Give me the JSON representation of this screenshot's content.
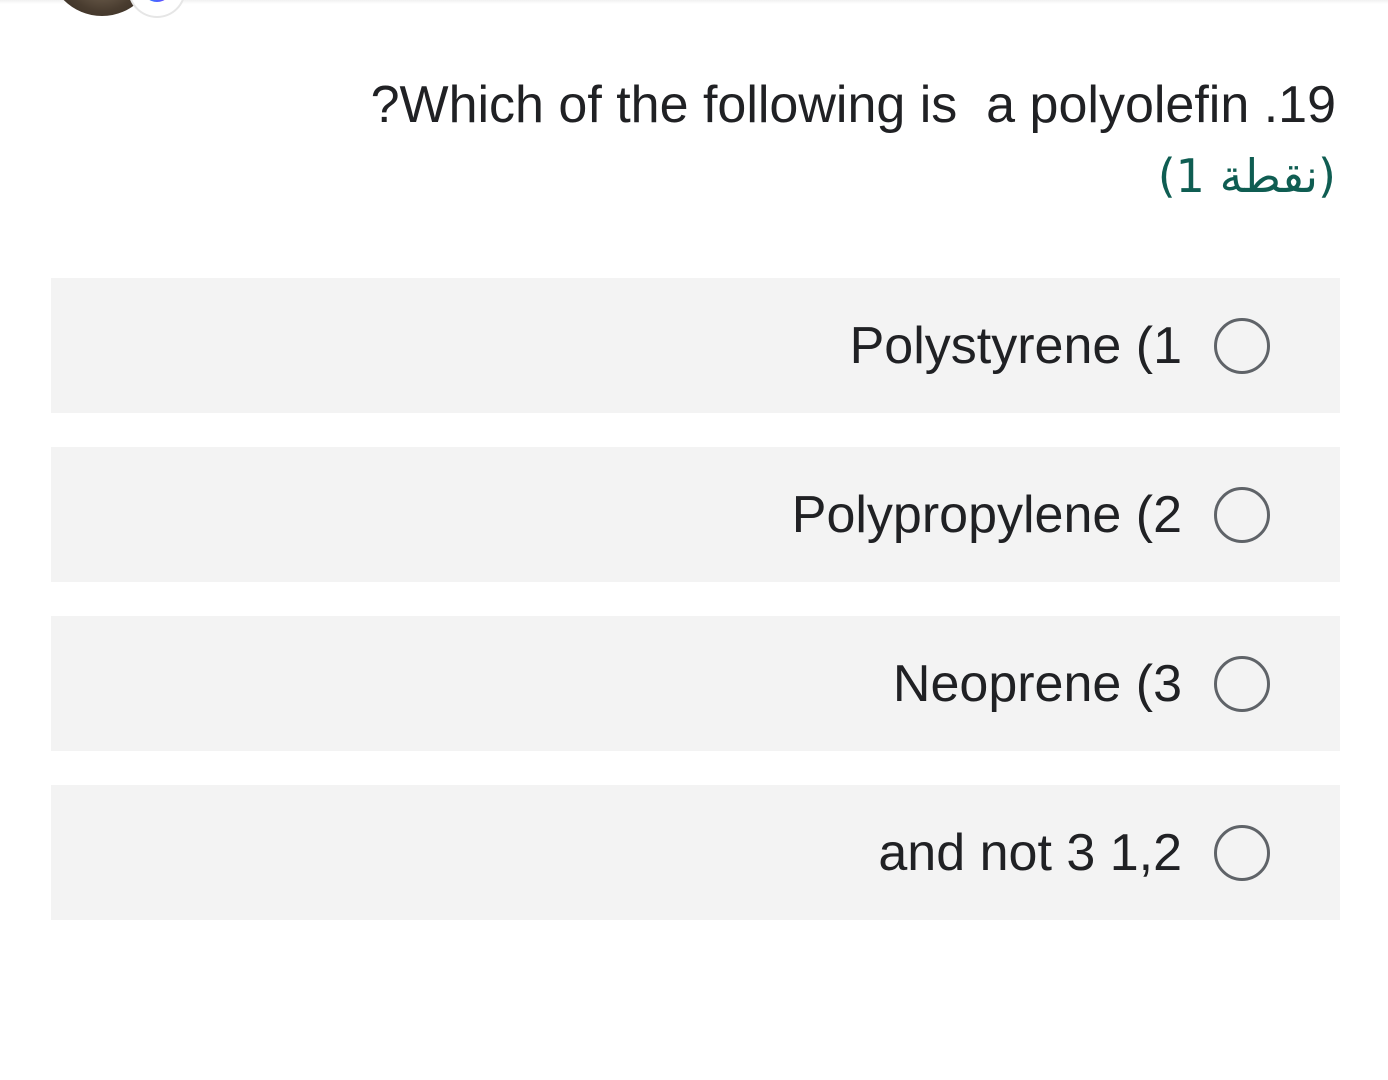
{
  "question": {
    "title": "?Which of the following is  a polyolefin .19",
    "points": "(1 نقطة)"
  },
  "options": [
    {
      "label": "Polystyrene (1",
      "selected": false
    },
    {
      "label": "Polypropylene (2",
      "selected": false
    },
    {
      "label": "Neoprene (3",
      "selected": false
    },
    {
      "label": "and not 3 1,2",
      "selected": false
    }
  ],
  "colors": {
    "option_background": "#f3f3f3",
    "points_text": "#0f5d52",
    "radio_border": "#5f6368"
  }
}
